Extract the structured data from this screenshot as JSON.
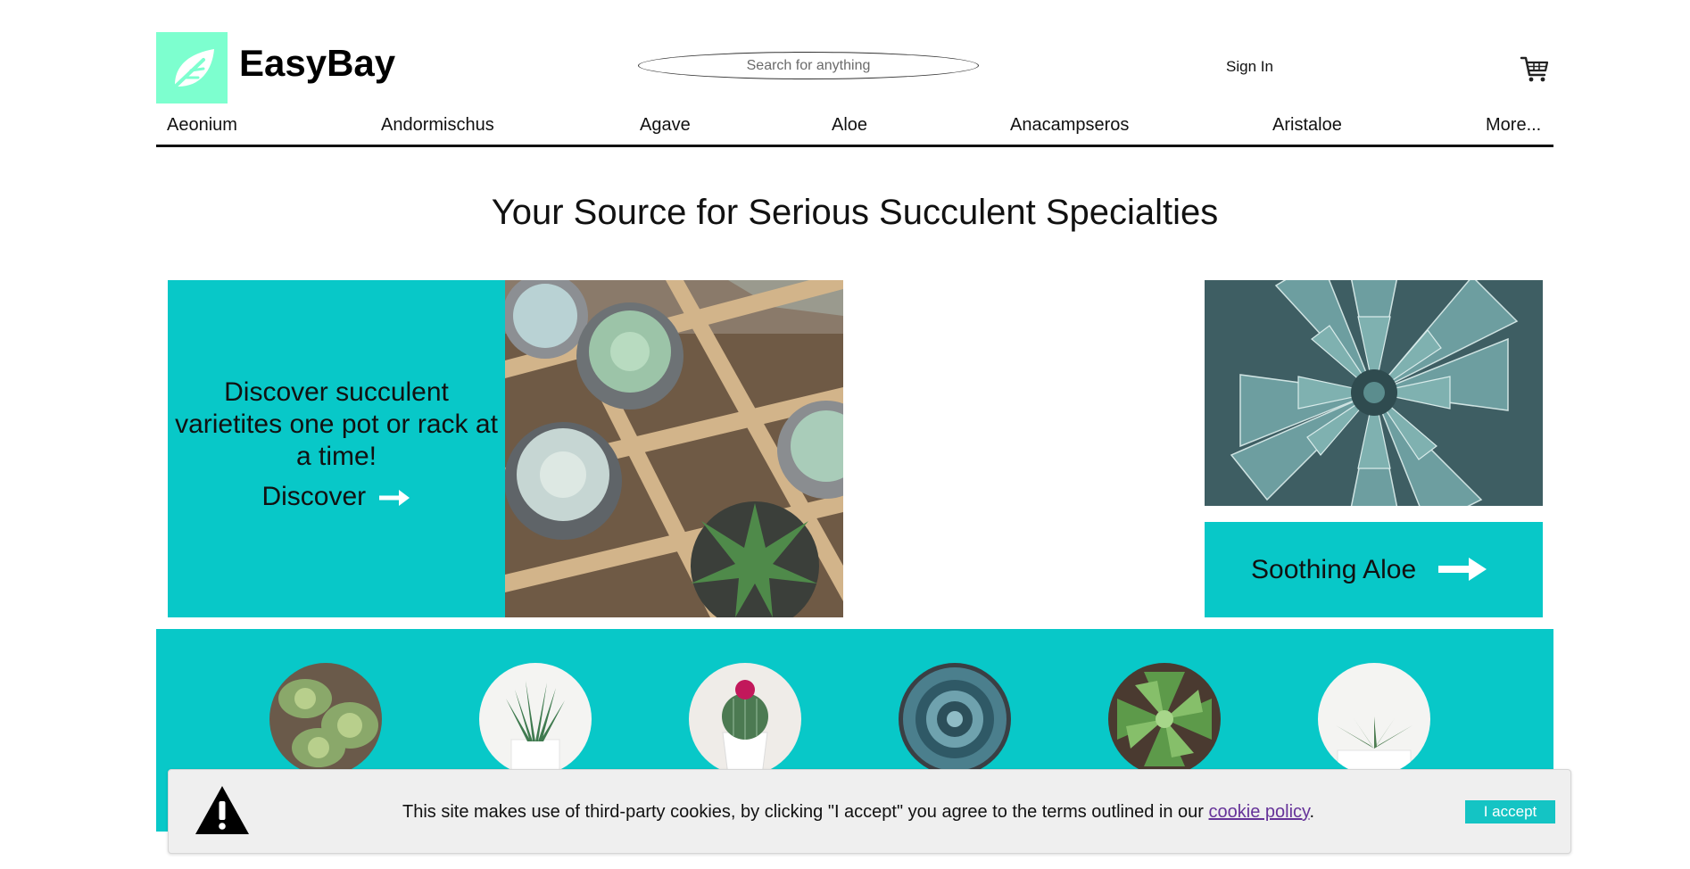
{
  "brand": {
    "name": "EasyBay",
    "logo_color": "#7dffcf"
  },
  "search": {
    "placeholder": "Search for anything",
    "value": ""
  },
  "header": {
    "signin_label": "Sign In",
    "cart_icon": "cart-icon"
  },
  "categories": [
    "Aeonium",
    "Andormischus",
    "Agave",
    "Aloe",
    "Anacampseros",
    "Aristaloe",
    "More..."
  ],
  "headline": "Your Source for Serious Succulent Specialties",
  "hero": {
    "text": "Discover succulent varietites one pot or rack at a time!",
    "link_label": "Discover",
    "arrow_icon": "arrow-right-icon",
    "panel_color": "#08c8c8"
  },
  "promo": {
    "aloe_label": "Soothing Aloe",
    "arrow_icon": "arrow-right-icon"
  },
  "featured_circles": [
    "echeveria-photo",
    "haworthia-photo",
    "cactus-photo",
    "blue-rosette-photo",
    "sempervivum-photo",
    "potted-rosette-photo"
  ],
  "cookie": {
    "warning_icon": "warning-icon",
    "text_before": "This site makes use of third-party cookies, by clicking \"I accept\" you agree to the terms outlined in our ",
    "link_label": "cookie policy",
    "text_after": ".",
    "accept_label": "I accept",
    "accept_color": "#14c4c4"
  },
  "colors": {
    "accent": "#08c8c8",
    "link_visited": "#663399"
  }
}
